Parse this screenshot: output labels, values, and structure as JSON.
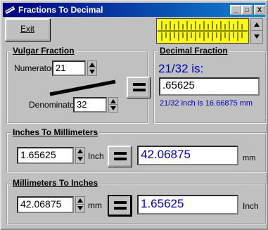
{
  "window": {
    "title": "Fractions To Decimal",
    "minimize_label": "_",
    "maximize_label": "□",
    "close_label": "X"
  },
  "toolbar": {
    "exit_label": "Exit"
  },
  "vulgar": {
    "title": "Vulgar Fraction",
    "numerator_label": "Numerator",
    "numerator_value": "21",
    "denominator_label": "Denominator",
    "denominator_value": "32"
  },
  "decimal": {
    "title": "Decimal Fraction",
    "heading": "21/32 is:",
    "value": ".65625",
    "note": "21/32 inch is 16.66875 mm"
  },
  "inches_to_mm": {
    "title": "Inches To Millimeters",
    "input_value": "1.65625",
    "unit_in": "Inch",
    "result": "42.06875",
    "unit_out": "mm"
  },
  "mm_to_inches": {
    "title": "Millimeters To Inches",
    "input_value": "42.06875",
    "unit_in": "mm",
    "result": "1.65625",
    "unit_out": "Inch"
  },
  "colors": {
    "title_bar_start": "#000080",
    "title_bar_end": "#1084d0",
    "accent_blue": "#0000c0",
    "ruler_yellow": "#ffff00"
  },
  "icons": [
    "ruler-icon",
    "minimize-icon",
    "maximize-icon",
    "close-icon",
    "equals-icon",
    "spinner-icon",
    "tape-measure-icon"
  ]
}
